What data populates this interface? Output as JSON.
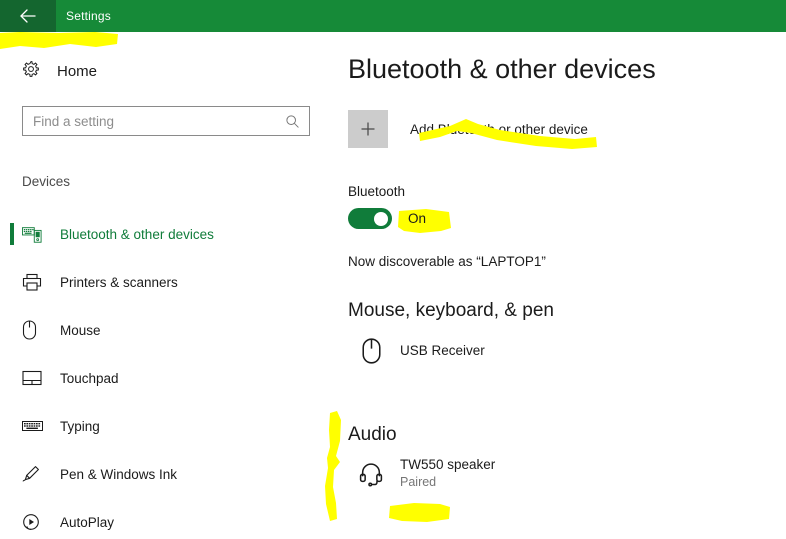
{
  "window": {
    "title": "Settings",
    "back_icon": "back-arrow-icon",
    "titlebar_color": "#168a38",
    "back_button_color": "#14662f"
  },
  "sidebar": {
    "home_label": "Home",
    "home_icon": "gear-icon",
    "search": {
      "placeholder": "Find a setting",
      "value": "",
      "icon": "search-icon"
    },
    "group_header": "Devices",
    "accent_color": "#107c3a",
    "items": [
      {
        "label": "Bluetooth & other devices",
        "icon": "bluetooth-devices-icon",
        "selected": true
      },
      {
        "label": "Printers & scanners",
        "icon": "printer-icon",
        "selected": false
      },
      {
        "label": "Mouse",
        "icon": "mouse-icon",
        "selected": false
      },
      {
        "label": "Touchpad",
        "icon": "touchpad-icon",
        "selected": false
      },
      {
        "label": "Typing",
        "icon": "keyboard-icon",
        "selected": false
      },
      {
        "label": "Pen & Windows Ink",
        "icon": "pen-icon",
        "selected": false
      },
      {
        "label": "AutoPlay",
        "icon": "autoplay-icon",
        "selected": false
      }
    ]
  },
  "main": {
    "page_title": "Bluetooth & other devices",
    "add_device": {
      "label": "Add Bluetooth or other device",
      "icon": "plus-icon"
    },
    "bluetooth": {
      "label": "Bluetooth",
      "toggle_state": "On",
      "toggle_on": true,
      "toggle_color": "#107c3a",
      "discoverable_text": "Now discoverable as “LAPTOP1”"
    },
    "sections": [
      {
        "heading": "Mouse, keyboard, & pen",
        "devices": [
          {
            "name": "USB Receiver",
            "status": "",
            "icon": "mouse-icon"
          }
        ]
      },
      {
        "heading": "Audio",
        "devices": [
          {
            "name": "TW550 speaker",
            "status": "Paired",
            "icon": "headset-icon"
          }
        ]
      }
    ]
  },
  "annotations": {
    "highlighter_color": "#ffff00",
    "marks": [
      {
        "name": "highlight-near-back-button",
        "shape": "blob"
      },
      {
        "name": "highlight-add-bluetooth-device",
        "shape": "stroke"
      },
      {
        "name": "highlight-bluetooth-on-state",
        "shape": "blob"
      },
      {
        "name": "highlight-audio-section-bracket",
        "shape": "vertical-stroke"
      },
      {
        "name": "highlight-paired-status",
        "shape": "blob"
      }
    ]
  }
}
